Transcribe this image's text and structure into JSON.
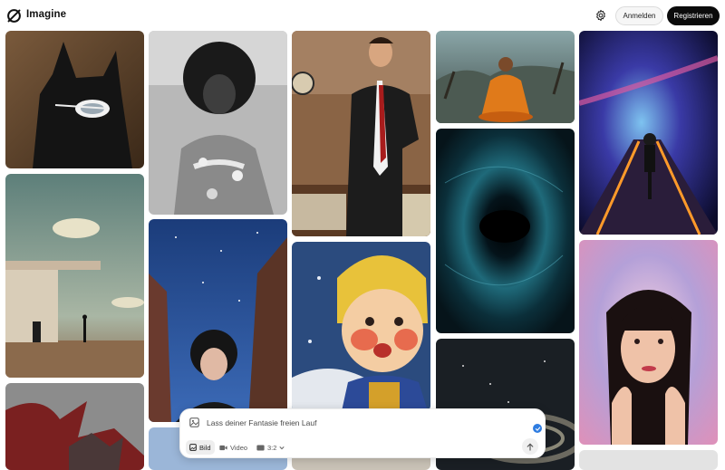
{
  "app": {
    "brand": "Imagine",
    "login_label": "Anmelden",
    "register_label": "Registrieren"
  },
  "gallery": {
    "tiles": [
      {
        "name": "cat-with-sunglasses-image"
      },
      {
        "name": "woman-afro-portrait-image"
      },
      {
        "name": "man-in-suit-office-image"
      },
      {
        "name": "monk-meditating-image"
      },
      {
        "name": "cyclist-space-road-image"
      },
      {
        "name": "modern-house-figure-image"
      },
      {
        "name": "black-hole-vortex-image"
      },
      {
        "name": "girl-night-sky-image"
      },
      {
        "name": "cartoon-boy-image"
      },
      {
        "name": "woman-portrait-colorful-image"
      },
      {
        "name": "dragon-image"
      },
      {
        "name": "dark-swirl-image"
      }
    ]
  },
  "prompt": {
    "placeholder": "Lass deiner Fantasie freien Lauf",
    "modes": {
      "image_label": "Bild",
      "video_label": "Video",
      "ratio_label": "3:2"
    }
  },
  "colors": {
    "accent": "#2f7de1",
    "register_bg": "#0b0b0b"
  }
}
